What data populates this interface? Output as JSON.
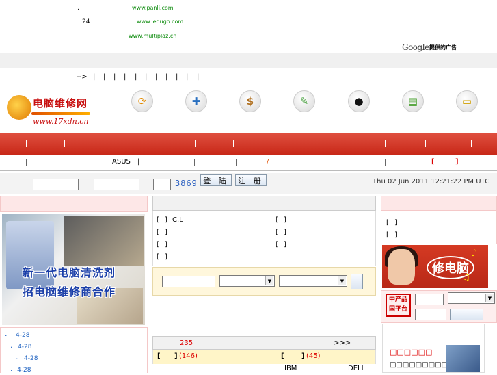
{
  "ads": {
    "comma": ",",
    "line1_url": "www.panli.com",
    "line2_num": "24",
    "line2_url": "www.lequgo.com",
    "line3_url": "www.multiplaz.cn",
    "google_logo": "Google",
    "google_provided": "提供的广告"
  },
  "nav": {
    "arrow": "-->",
    "pipes": [
      "|",
      "|",
      "|",
      "|",
      "|",
      "|",
      "|",
      "|",
      "|",
      "|",
      "|"
    ]
  },
  "logo": {
    "name_cn": "电脑维修网",
    "url": "www.17xdn.cn"
  },
  "icons": [
    "refresh-icon",
    "puzzle-icon",
    "money-bag-icon",
    "tools-icon",
    "qq-penguin-icon",
    "books-icon",
    "open-book-icon"
  ],
  "subnav": {
    "asus": "ASUS",
    "pipe": "|",
    "slash": "/",
    "bracket_open": "[",
    "bracket_close": "]"
  },
  "login": {
    "captcha": "3869",
    "login_label": "登 陆",
    "register_label": "注 册",
    "datetime": "Thu 02 Jun 2011 12:21:22 PM UTC"
  },
  "banner_left": {
    "line1": "新一代电脑清洗剂",
    "line2": "招电脑维修商合作"
  },
  "left_list": {
    "bullet": "·",
    "items": [
      "4-28",
      "4-28",
      "4-28",
      "4-28"
    ]
  },
  "center": {
    "bracket_rows_left": [
      {
        "open": "[",
        "close": "]",
        "text": "C.L"
      },
      {
        "open": "[",
        "close": "]",
        "text": ""
      },
      {
        "open": "[",
        "close": "]",
        "text": ""
      },
      {
        "open": "[",
        "close": "]",
        "text": ""
      }
    ],
    "bracket_rows_right": [
      {
        "open": "[",
        "close": "]"
      },
      {
        "open": "[",
        "close": "]"
      },
      {
        "open": "[",
        "close": "]"
      }
    ],
    "count_235": "235",
    "more": ">>>",
    "cat1_count": "(146)",
    "cat2_count": "(45)",
    "brand_ibm": "IBM",
    "brand_dell": "DELL"
  },
  "right": {
    "bracket_rows": [
      {
        "open": "[",
        "close": "]"
      },
      {
        "open": "[",
        "close": "]"
      }
    ],
    "xiu_label": "修电脑",
    "seal_text_1": "中产品",
    "seal_text_2": "国平台",
    "news_text": "□□□□□□",
    "news_sub": "□□□□□□□□□□□"
  },
  "colors": {
    "red_bar": "#d23a2a",
    "green_ad": "#0a8a0a",
    "captcha_blue": "#2a5fc0",
    "captcha_green": "#1a9a3a",
    "orange_text": "#e05000"
  }
}
